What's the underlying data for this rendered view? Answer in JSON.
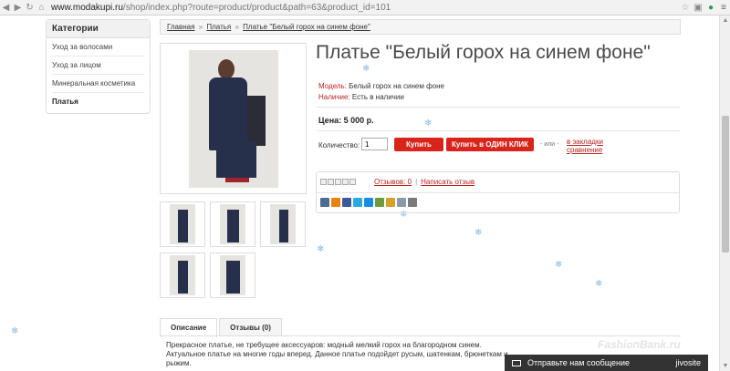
{
  "browser": {
    "url_host": "www.modakupi.ru",
    "url_path": "/shop/index.php?route=product/product&path=63&product_id=101"
  },
  "sidebar": {
    "title": "Категории",
    "items": [
      "Уход за волосами",
      "Уход за лицом",
      "Минеральная косметика",
      "Платья"
    ]
  },
  "breadcrumb": {
    "items": [
      "Главная",
      "Платья",
      "Платье \"Белый горох на синем фоне\""
    ],
    "separator": "»"
  },
  "product": {
    "title": "Платье \"Белый горох на синем фоне\"",
    "model_label": "Модель:",
    "model_value": "Белый горох на синем фоне",
    "availability_label": "Наличие:",
    "availability_value": "Есть в наличии",
    "price": "Цена: 5 000 р.",
    "quantity_label": "Количество:",
    "quantity_value": "1",
    "buy_label": "Купить",
    "one_click_label": "Купить в ОДИН КЛИК",
    "or_label": "- или -",
    "bookmark_label": "в закладки",
    "compare_label": "сравнение"
  },
  "reviews": {
    "count_label": "Отзывов: 0",
    "separator": "|",
    "write_label": "Написать отзыв",
    "rating_stars": 0
  },
  "share_icons": [
    {
      "name": "vk-icon",
      "color": "#4c6c91"
    },
    {
      "name": "odnoklassniki-icon",
      "color": "#ee8208"
    },
    {
      "name": "facebook-icon",
      "color": "#3b5998"
    },
    {
      "name": "twitter-icon",
      "color": "#2aa9e0"
    },
    {
      "name": "mailru-icon",
      "color": "#168de2"
    },
    {
      "name": "livejournal-icon",
      "color": "#6d9a3a"
    },
    {
      "name": "yandex-icon",
      "color": "#d6a02b"
    },
    {
      "name": "email-icon",
      "color": "#8a9aa6"
    },
    {
      "name": "print-icon",
      "color": "#7a7a7a"
    }
  ],
  "tabs": [
    "Описание",
    "Отзывы (0)"
  ],
  "description": "Прекрасное платье, не требущее аксессуаров: модный мелкий горох на благородном синем. Актуальное платье на многие годы вперед. Данное платье подойдет  русым, шатенкам, брюнеткам и рыжим.",
  "watermark": "FashionBank.ru",
  "chat": {
    "label": "Отправьте нам сообщение",
    "brand": "jivosite"
  },
  "colors": {
    "accent_red": "#d9241c",
    "link_red": "#bb2222",
    "snow": "#86b8e0"
  }
}
